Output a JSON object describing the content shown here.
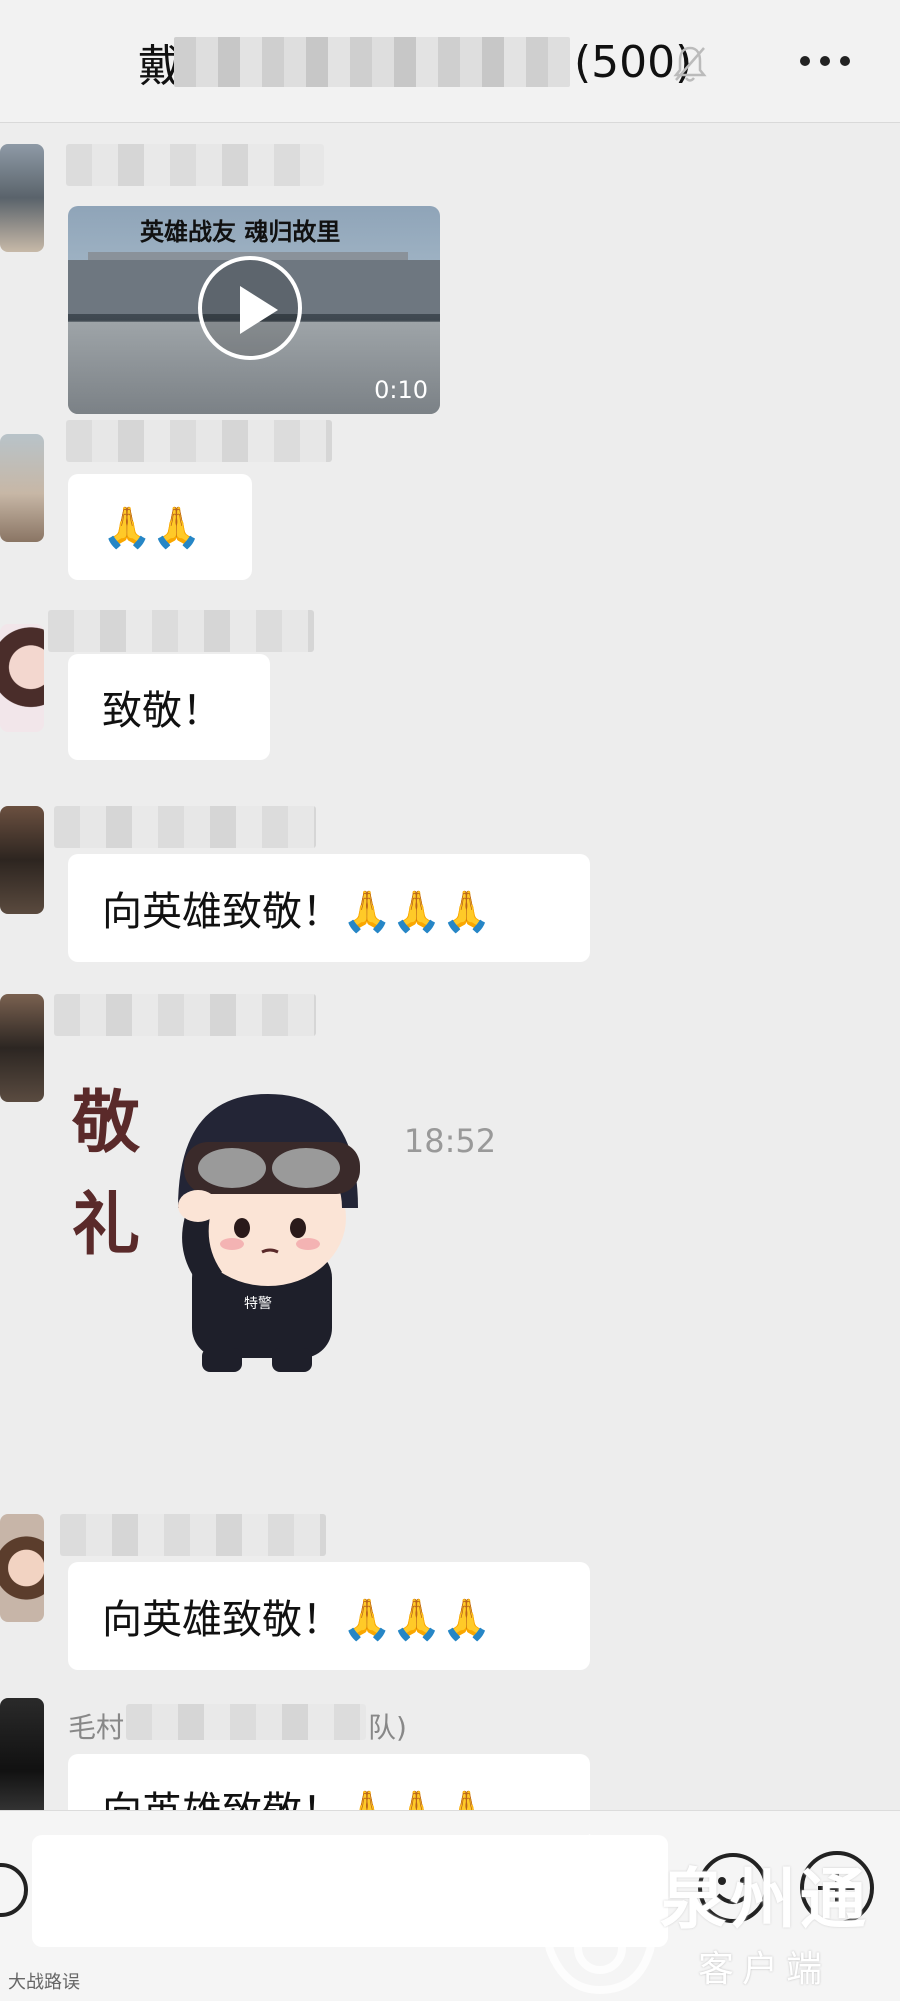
{
  "header": {
    "title_visible_char": "戴",
    "member_count": "(500)",
    "mute_icon": "bell-muted-icon",
    "more_icon": "ellipsis-icon"
  },
  "messages": [
    {
      "type": "video",
      "video_title": "英雄战友 魂归故里",
      "duration": "0:10"
    },
    {
      "type": "text",
      "text": "🙏🙏"
    },
    {
      "type": "text",
      "text": "致敬！"
    },
    {
      "type": "text",
      "text": "向英雄致敬！🙏🙏🙏"
    },
    {
      "type": "sticker",
      "sticker_text_1": "敬",
      "sticker_text_2": "礼",
      "badge": "特警"
    },
    {
      "type": "time",
      "text": "18:52"
    },
    {
      "type": "text",
      "text": "向英雄致敬！🙏🙏🙏"
    },
    {
      "type": "text",
      "sender_partial_start": "毛村",
      "sender_partial_end": "队)",
      "text": "向英雄致敬！🙏🙏🙏"
    }
  ],
  "input": {
    "voice_icon": "voice-icon",
    "emoji_icon": "emoji-icon",
    "plus_icon": "plus-icon"
  },
  "watermark": {
    "brand": "泉州通",
    "sub": "客户端",
    "corner": "大战路误"
  }
}
